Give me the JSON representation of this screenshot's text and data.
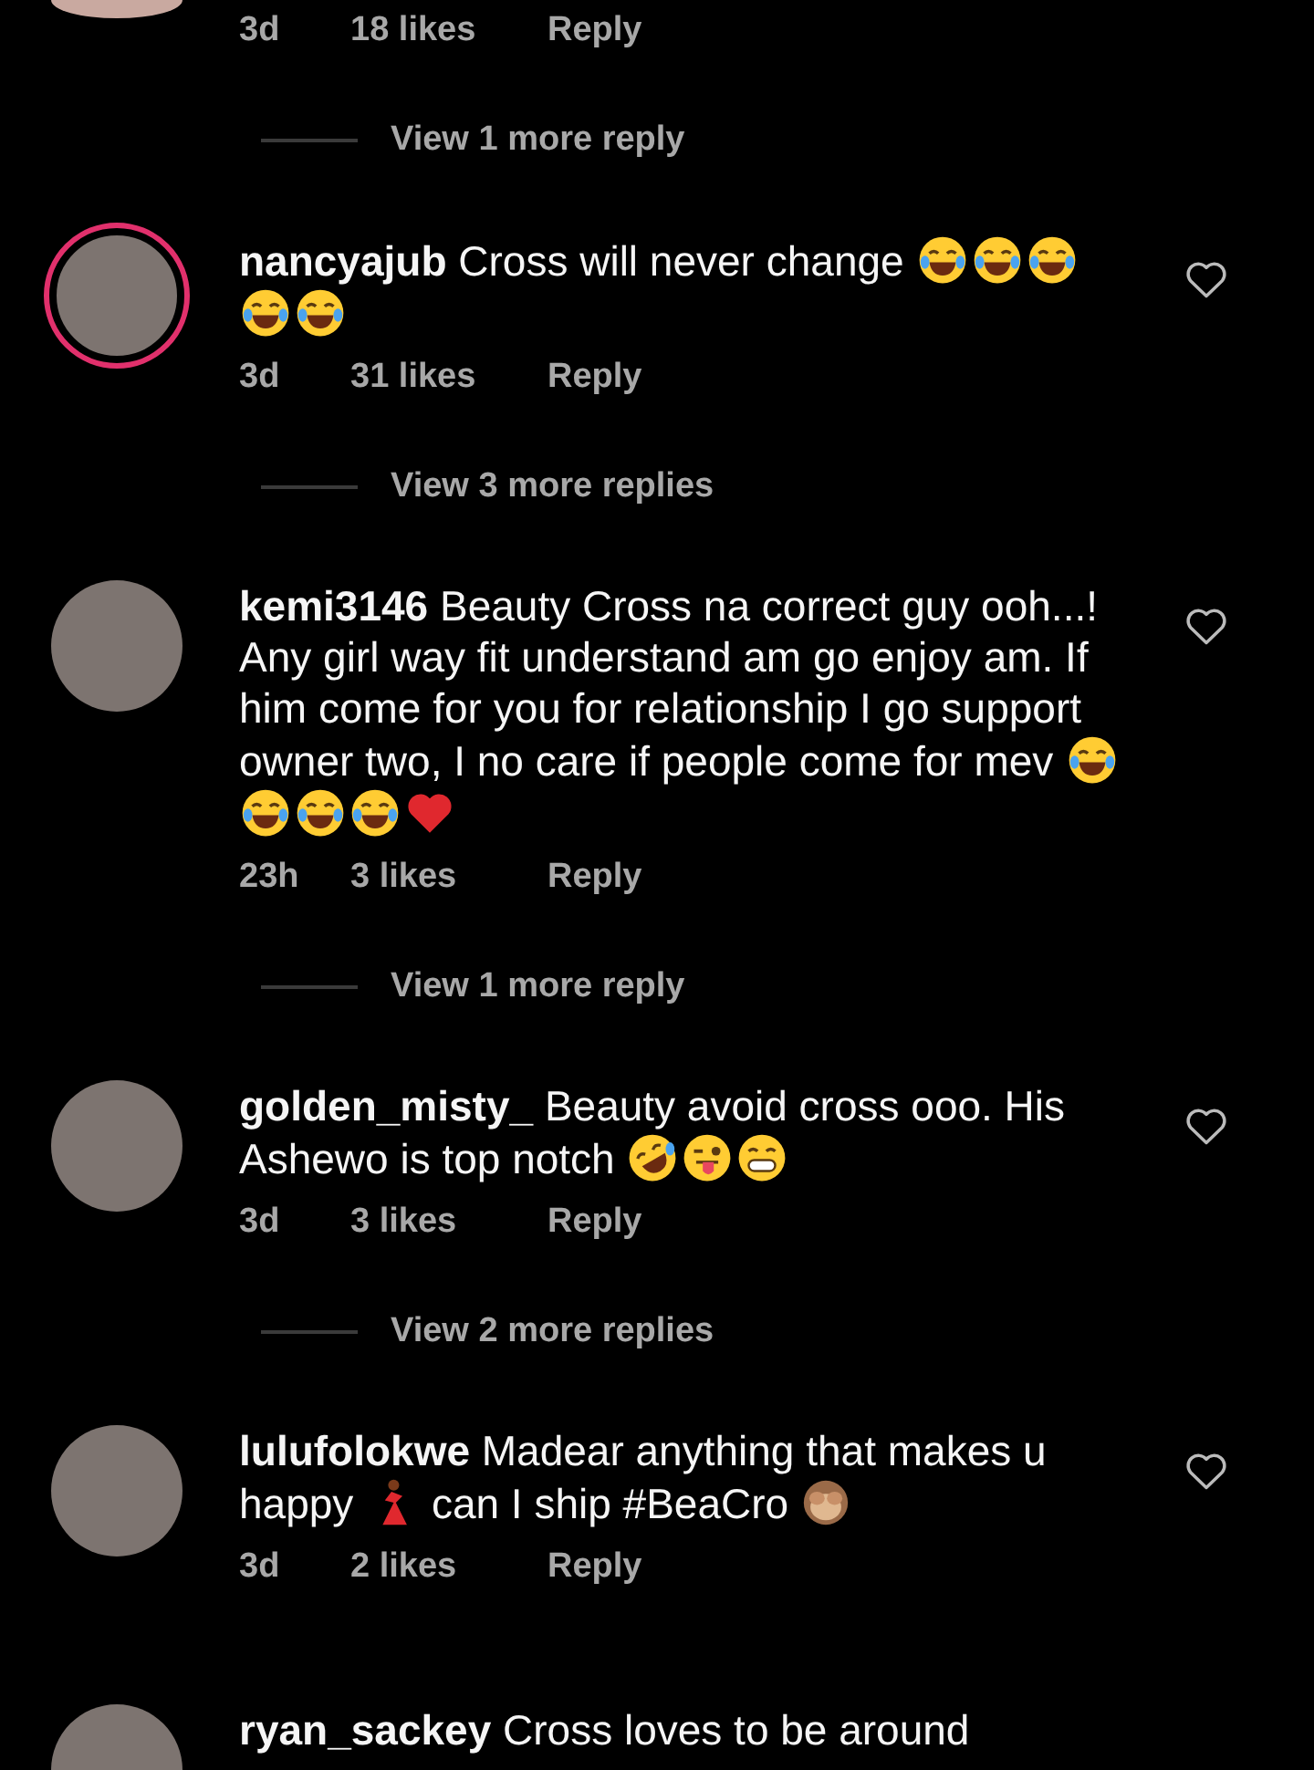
{
  "comments": [
    {
      "avatar": {
        "story_ring": false
      },
      "time": "3d",
      "likes": "18 likes",
      "reply": "Reply",
      "view_more": "View 1 more reply"
    },
    {
      "avatar": {
        "story_ring": true
      },
      "username": "nancyajub",
      "parts": [
        {
          "kind": "text",
          "text": "Cross will never change "
        },
        {
          "kind": "tears-of-joy"
        },
        {
          "kind": "tears-of-joy"
        },
        {
          "kind": "tears-of-joy"
        },
        {
          "kind": "tears-of-joy"
        },
        {
          "kind": "tears-of-joy"
        }
      ],
      "time": "3d",
      "likes": "31 likes",
      "reply": "Reply",
      "view_more": "View 3 more replies"
    },
    {
      "avatar": {
        "story_ring": false
      },
      "username": "kemi3146",
      "parts": [
        {
          "kind": "text",
          "text": "Beauty Cross na correct guy ooh...! Any girl way fit understand am go enjoy am. If him come for you for relationship I go support owner two, I no care if people come for mev "
        },
        {
          "kind": "tears-of-joy"
        },
        {
          "kind": "tears-of-joy"
        },
        {
          "kind": "tears-of-joy"
        },
        {
          "kind": "tears-of-joy"
        },
        {
          "kind": "heart"
        }
      ],
      "time": "23h",
      "likes": "3 likes",
      "reply": "Reply",
      "view_more": "View 1 more reply"
    },
    {
      "avatar": {
        "story_ring": false
      },
      "username": "golden_misty_",
      "parts": [
        {
          "kind": "text",
          "text": "Beauty avoid cross ooo. His Ashewo is top notch "
        },
        {
          "kind": "rolling-laugh"
        },
        {
          "kind": "winking-tongue"
        },
        {
          "kind": "grin"
        }
      ],
      "time": "3d",
      "likes": "3 likes",
      "reply": "Reply",
      "view_more": "View 2 more replies"
    },
    {
      "avatar": {
        "story_ring": false
      },
      "username": "lulufolokwe",
      "parts": [
        {
          "kind": "text",
          "text": "Madear anything that makes u happy "
        },
        {
          "kind": "dancer"
        },
        {
          "kind": "text",
          "text": " can I ship #BeaCro "
        },
        {
          "kind": "see-no-evil"
        }
      ],
      "time": "3d",
      "likes": "2 likes",
      "reply": "Reply"
    },
    {
      "avatar": {
        "story_ring": false
      },
      "username": "ryan_sackey",
      "parts": [
        {
          "kind": "text",
          "text": "Cross loves to be around"
        }
      ]
    }
  ]
}
